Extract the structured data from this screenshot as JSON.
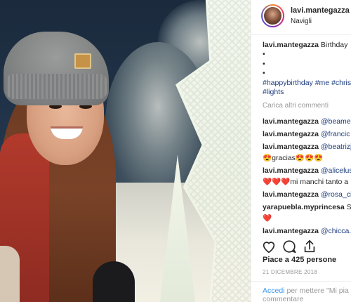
{
  "post": {
    "username": "lavi.mantegazza",
    "follow_dot": "•",
    "location": "Navigli"
  },
  "caption": {
    "username": "lavi.mantegazza",
    "text": "Birthday",
    "bullets": [
      "•",
      "•",
      "•"
    ],
    "hashtags_line1": "#happybirthday #me #chris",
    "hashtags_line2": "#lights"
  },
  "comments": {
    "load_more": "Carica altri commenti",
    "items": [
      {
        "user": "lavi.mantegazza",
        "text": "@beamel",
        "continuation": ""
      },
      {
        "user": "lavi.mantegazza",
        "text": "@francic",
        "continuation": ""
      },
      {
        "user": "lavi.mantegazza",
        "text": "@beatrizj",
        "continuation": "😍gracias😍😍😍"
      },
      {
        "user": "lavi.mantegazza",
        "text": "@alicelus",
        "continuation": "❤️❤️❤️mi manchi tanto a"
      },
      {
        "user": "lavi.mantegazza",
        "text": "@rosa_ci",
        "continuation": ""
      },
      {
        "user": "yarapuebla.myprincesa",
        "text": "S",
        "continuation": "❤️"
      },
      {
        "user": "lavi.mantegazza",
        "text": "@chicca.",
        "continuation": ""
      }
    ]
  },
  "actions": {
    "like_icon": "heart-icon",
    "comment_icon": "comment-icon",
    "share_icon": "share-icon"
  },
  "likes": "Piace a 425 persone",
  "date": "21 DICEMBRE 2018",
  "footer": {
    "login_link": "Accedi",
    "text": "per mettere \"Mi pia",
    "text2": "commentare"
  },
  "colors": {
    "link_blue": "#3897f0",
    "mention_blue": "#1a3a7a",
    "muted": "#999999"
  }
}
